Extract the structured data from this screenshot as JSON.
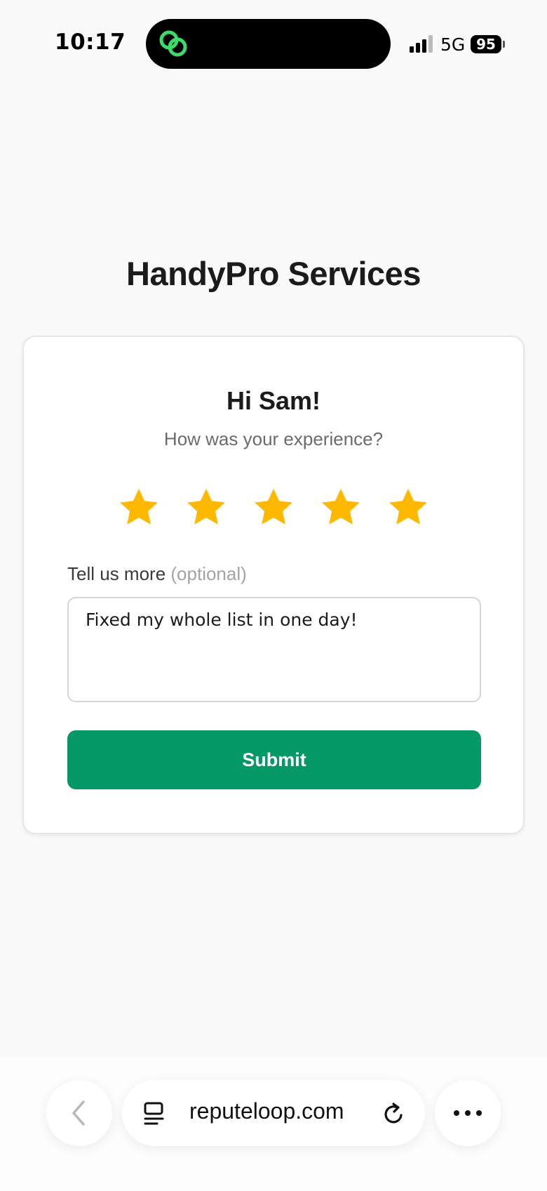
{
  "status_bar": {
    "time": "10:17",
    "network": "5G",
    "battery": "95",
    "island_icon": "linked-rings-icon"
  },
  "page": {
    "business_name": "HandyPro Services",
    "greeting": "Hi Sam!",
    "prompt": "How was your experience?",
    "rating": {
      "value": 5,
      "max": 5,
      "star_color": "#FFB800"
    },
    "feedback_label": "Tell us more",
    "feedback_optional": "(optional)",
    "feedback_value": "Fixed my whole list in one day!",
    "submit_label": "Submit",
    "submit_color": "#039866"
  },
  "browser": {
    "url": "reputeloop.com",
    "icons": [
      "back-icon",
      "tabs-icon",
      "reload-icon",
      "more-icon"
    ]
  }
}
